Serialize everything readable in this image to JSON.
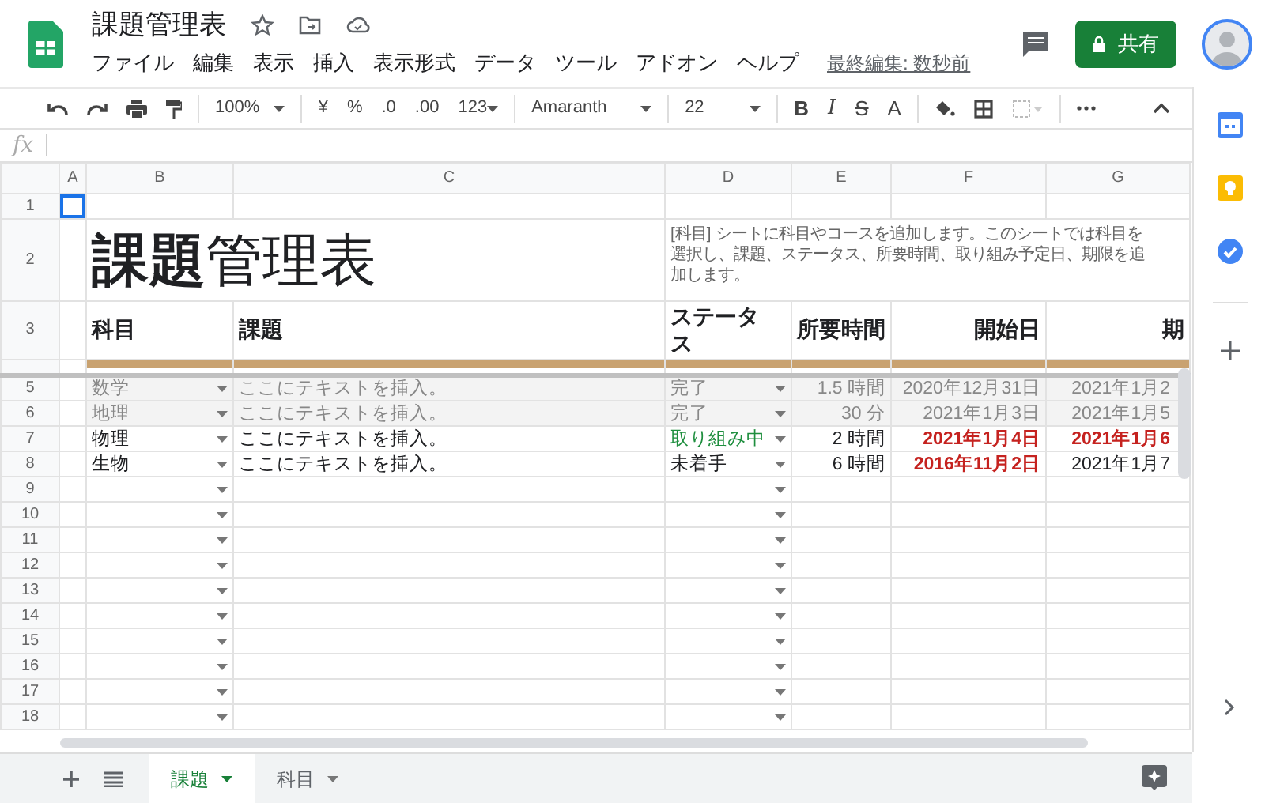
{
  "app": {
    "title": "課題管理表",
    "menu": [
      "ファイル",
      "編集",
      "表示",
      "挿入",
      "表示形式",
      "データ",
      "ツール",
      "アドオン",
      "ヘルプ"
    ],
    "last_edit": "最終編集: 数秒前",
    "share": "共有"
  },
  "toolbar": {
    "zoom": "100%",
    "currency": "¥",
    "percent": "%",
    "decrease_decimals": ".0",
    "increase_decimals": ".00",
    "number_format": "123",
    "font": "Amaranth",
    "font_size": "22",
    "bold": "B",
    "italic": "I",
    "strike": "S",
    "text_color": "A"
  },
  "formula_bar": {
    "label": "fx"
  },
  "columns": [
    "A",
    "B",
    "C",
    "D",
    "E",
    "F",
    "G"
  ],
  "sheet": {
    "title": "**課題**管理表",
    "description_lines": [
      "[科目] シートに科目やコースを追加します。このシートでは科目を",
      "選択し、課題、ステータス、所要時間、取り組み予定日、期限を追",
      "加します。"
    ],
    "headers": [
      "科目",
      "課題",
      "ステータス",
      "所要時間",
      "開始日",
      "期"
    ],
    "header_row_numbers": [
      "1",
      "2",
      "3"
    ]
  },
  "rows": [
    {
      "num": "5",
      "kind": "done",
      "subject": "数学",
      "task": "ここにテキストを挿入。",
      "status": "完了",
      "duration": "1.5 時間",
      "start": {
        "text": "2020年12月31日",
        "overdue": false
      },
      "due": {
        "text": "2021年1月2",
        "overdue": false
      }
    },
    {
      "num": "6",
      "kind": "done",
      "subject": "地理",
      "task": "ここにテキストを挿入。",
      "status": "完了",
      "duration": "30 分",
      "start": {
        "text": "2021年1月3日",
        "overdue": false
      },
      "due": {
        "text": "2021年1月5",
        "overdue": false
      }
    },
    {
      "num": "7",
      "kind": "in_progress",
      "subject": "物理",
      "task": "ここにテキストを挿入。",
      "status": "取り組み中",
      "duration": "2 時間",
      "start": {
        "text": "2021年1月4日",
        "overdue": true
      },
      "due": {
        "text": "2021年1月6",
        "overdue": true
      }
    },
    {
      "num": "8",
      "kind": "not_started",
      "subject": "生物",
      "task": "ここにテキストを挿入。",
      "status": "未着手",
      "duration": "6 時間",
      "start": {
        "text": "2016年11月2日",
        "overdue": true
      },
      "due": {
        "text": "2021年1月7",
        "overdue": false
      }
    },
    {
      "num": "9"
    },
    {
      "num": "10"
    },
    {
      "num": "11"
    },
    {
      "num": "12"
    },
    {
      "num": "13"
    },
    {
      "num": "14"
    },
    {
      "num": "15"
    },
    {
      "num": "16"
    },
    {
      "num": "17"
    },
    {
      "num": "18"
    }
  ],
  "tabs": [
    {
      "label": "課題",
      "selected": true
    },
    {
      "label": "科目",
      "selected": false
    }
  ]
}
